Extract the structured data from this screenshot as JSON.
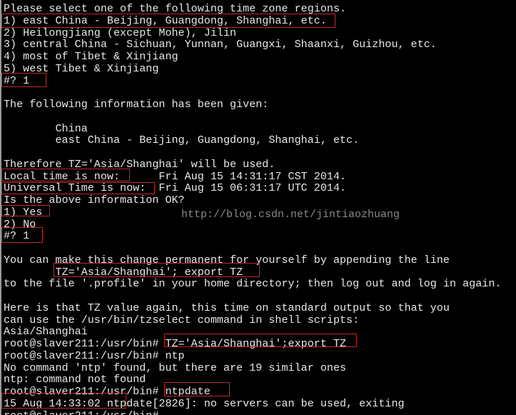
{
  "terminal": {
    "lines": [
      "Please select one of the following time zone regions.",
      "1) east China - Beijing, Guangdong, Shanghai, etc.",
      "2) Heilongjiang (except Mohe), Jilin",
      "3) central China - Sichuan, Yunnan, Guangxi, Shaanxi, Guizhou, etc.",
      "4) most of Tibet & Xinjiang",
      "5) west Tibet & Xinjiang",
      "#? 1",
      "",
      "The following information has been given:",
      "",
      "        China",
      "        east China - Beijing, Guangdong, Shanghai, etc.",
      "",
      "Therefore TZ='Asia/Shanghai' will be used.",
      "Local time is now:      Fri Aug 15 14:31:17 CST 2014.",
      "Universal Time is now:  Fri Aug 15 06:31:17 UTC 2014.",
      "Is the above information OK?",
      "1) Yes",
      "2) No",
      "#? 1",
      "",
      "You can make this change permanent for yourself by appending the line",
      "        TZ='Asia/Shanghai'; export TZ",
      "to the file '.profile' in your home directory; then log out and log in again.",
      "",
      "Here is that TZ value again, this time on standard output so that you",
      "can use the /usr/bin/tzselect command in shell scripts:",
      "Asia/Shanghai",
      "root@slaver211:/usr/bin# TZ='Asia/Shanghai';export TZ",
      "root@slaver211:/usr/bin# ntp",
      "No command 'ntp' found, but there are 19 similar ones",
      "ntp: command not found",
      "root@slaver211:/usr/bin# ntpdate",
      "15 Aug 14:33:02 ntpdate[2826]: no servers can be used, exiting",
      "root@slaver211:/usr/bin#"
    ],
    "watermark": "http://blog.csdn.net/jintiaozhuang",
    "highlight_color": "#c0282d"
  }
}
